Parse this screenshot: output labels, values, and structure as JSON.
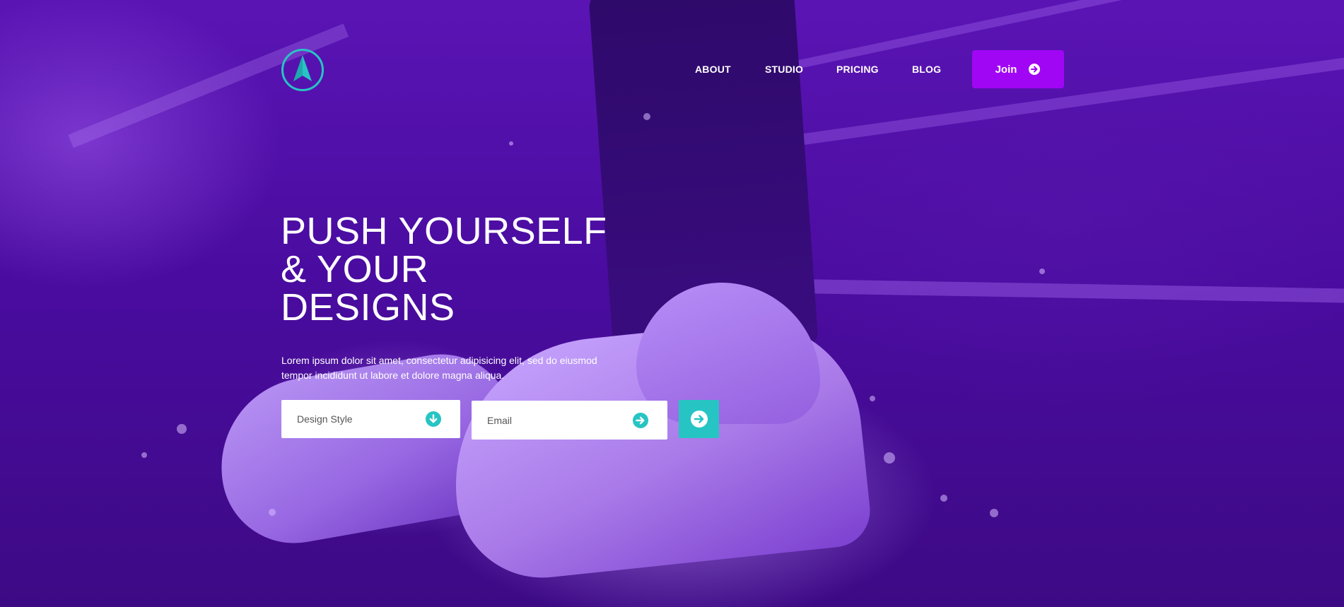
{
  "brand": {
    "logo_icon": "arrow-navigation-logo",
    "accent": "#27c4c4"
  },
  "nav": {
    "items": [
      {
        "label": "ABOUT"
      },
      {
        "label": "STUDIO"
      },
      {
        "label": "PRICING"
      },
      {
        "label": "BLOG"
      }
    ],
    "join_label": "Join",
    "join_icon": "arrow-circle-right-icon",
    "join_color": "#a106f4"
  },
  "hero": {
    "headline_lines": [
      "PUSH YOURSELF",
      "& YOUR",
      "DESIGNS"
    ],
    "subtext": "Lorem ipsum dolor sit amet, consectetur adipisicing elit, sed do eiusmod tempor incididunt ut labore et dolore magna aliqua.",
    "background_tint": "#4a0c9c"
  },
  "form": {
    "style_select": {
      "selected": "Design Style",
      "icon": "arrow-circle-down-icon"
    },
    "email": {
      "placeholder": "Email",
      "value": "",
      "icon": "arrow-circle-right-icon"
    },
    "submit_icon": "arrow-circle-right-icon",
    "submit_color": "#27c4c4"
  }
}
